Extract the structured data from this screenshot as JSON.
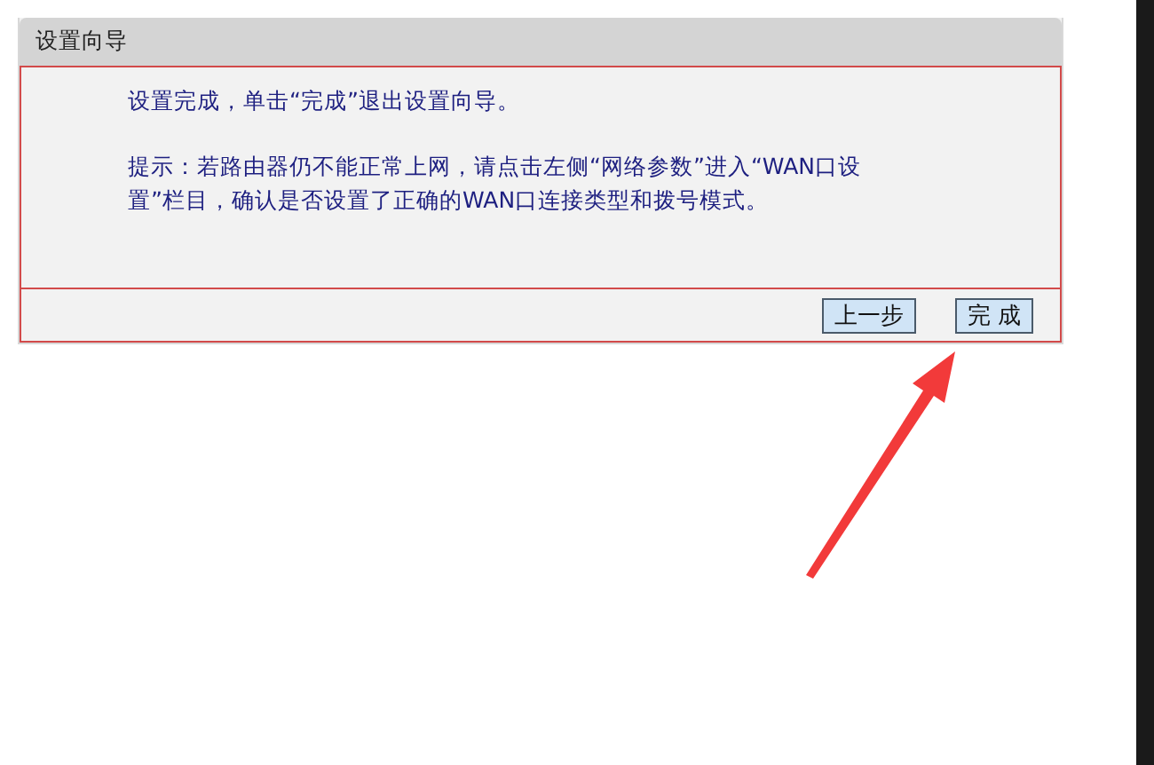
{
  "panel": {
    "title": "设置向导",
    "message": "设置完成，单击“完成”退出设置向导。",
    "hint_lines": [
      "提示：若路由器仍不能正常上网，请点击左侧“网络参数”进入“WAN口设",
      "置”栏目，确认是否设置了正确的WAN口连接类型和拨号模式。"
    ],
    "buttons": [
      {
        "label": "上一步"
      },
      {
        "label": "完 成"
      }
    ]
  }
}
